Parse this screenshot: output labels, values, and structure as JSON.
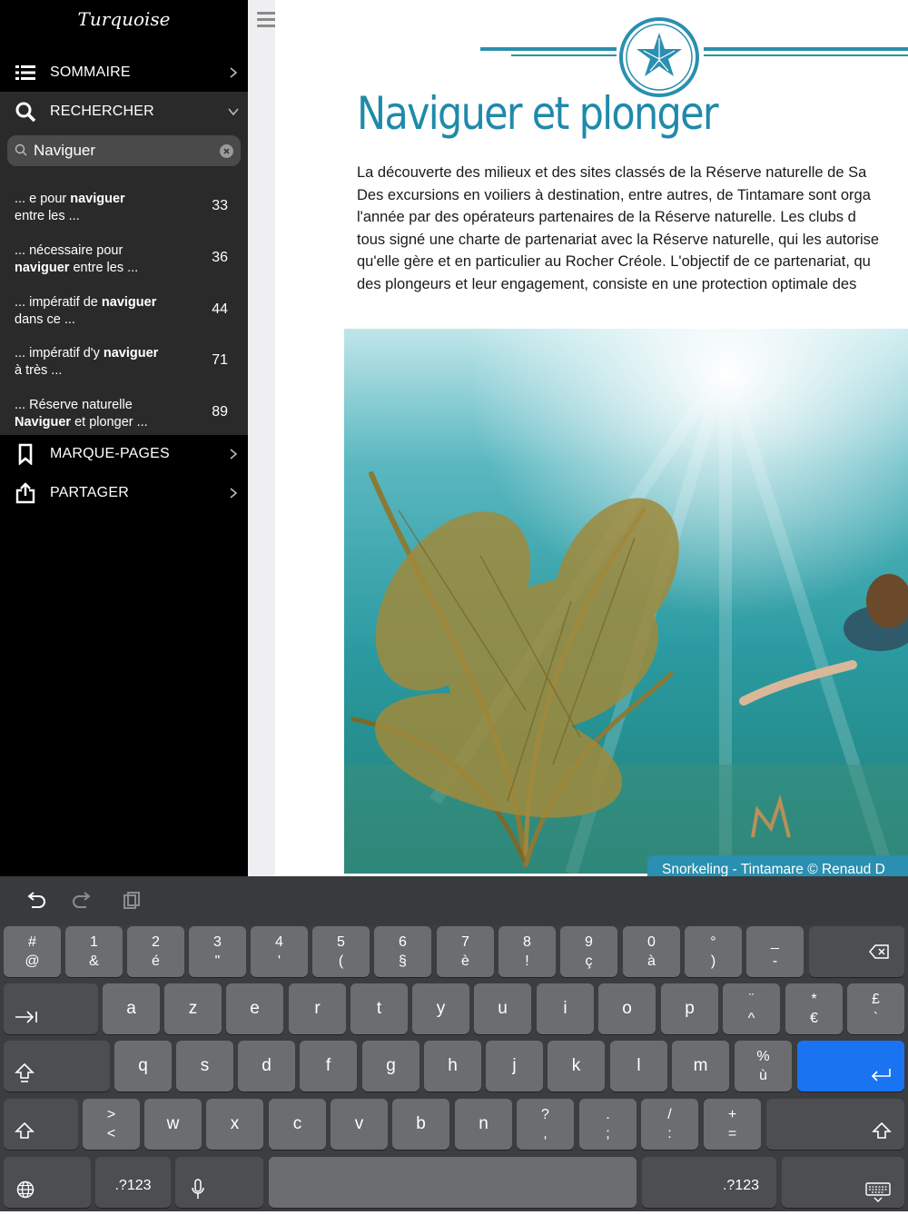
{
  "sidebar": {
    "logo": "Turquoise",
    "menu": {
      "sommaire": "SOMMAIRE",
      "rechercher": "RECHERCHER",
      "marque_pages": "MARQUE-PAGES",
      "partager": "PARTAGER"
    },
    "search": {
      "value": "Naviguer"
    },
    "results": [
      {
        "pre": "... e pour ",
        "hit": "naviguer",
        "post": "",
        "line2": "entre les ...",
        "page": "33"
      },
      {
        "pre": "... nécessaire pour",
        "hit": "",
        "post": "",
        "line2hit": "naviguer",
        "line2": " entre les ...",
        "page": "36"
      },
      {
        "pre": "... impératif de ",
        "hit": "naviguer",
        "post": "",
        "line2": "dans ce ...",
        "page": "44"
      },
      {
        "pre": "... impératif d'y ",
        "hit": "naviguer",
        "post": "",
        "line2": "à très ...",
        "page": "71"
      },
      {
        "pre": "... Réserve naturelle",
        "hit": "",
        "post": "",
        "line2hit": "Naviguer",
        "line2": " et plonger ...",
        "page": "89"
      }
    ]
  },
  "page": {
    "title": "Naviguer et plonger",
    "lines": [
      "La découverte des milieux et des sites classés de la Réserve naturelle de Sa",
      "Des excursions en voiliers à destination, entre autres, de Tintamare sont orga",
      "l'année par des opérateurs partenaires de la Réserve naturelle. Les clubs d",
      "tous signé une charte de partenariat avec la Réserve naturelle, qui les autorise",
      "qu'elle gère et en particulier au Rocher Créole. L'objectif de ce partenariat, qu",
      "des plongeurs et leur engagement, consiste en une protection optimale des"
    ],
    "caption": "Snorkeling  - Tintamare © Renaud D"
  },
  "keyboard": {
    "row1": [
      {
        "top": "#",
        "bot": "@"
      },
      {
        "top": "1",
        "bot": "&"
      },
      {
        "top": "2",
        "bot": "é"
      },
      {
        "top": "3",
        "bot": "\""
      },
      {
        "top": "4",
        "bot": "'"
      },
      {
        "top": "5",
        "bot": "("
      },
      {
        "top": "6",
        "bot": "§"
      },
      {
        "top": "7",
        "bot": "è"
      },
      {
        "top": "8",
        "bot": "!"
      },
      {
        "top": "9",
        "bot": "ç"
      },
      {
        "top": "0",
        "bot": "à"
      },
      {
        "top": "°",
        "bot": ")"
      },
      {
        "top": "_",
        "bot": "-"
      }
    ],
    "row2": [
      "a",
      "z",
      "e",
      "r",
      "t",
      "y",
      "u",
      "i",
      "o",
      "p"
    ],
    "row2_extra": [
      {
        "top": "¨",
        "bot": "^"
      },
      {
        "top": "*",
        "bot": "€"
      },
      {
        "top": "£",
        "bot": "`"
      }
    ],
    "row3": [
      "q",
      "s",
      "d",
      "f",
      "g",
      "h",
      "j",
      "k",
      "l",
      "m"
    ],
    "row3_extra": {
      "top": "%",
      "bot": "ù"
    },
    "row4_first": {
      "top": ">",
      "bot": "<"
    },
    "row4": [
      "w",
      "x",
      "c",
      "v",
      "b",
      "n"
    ],
    "row4_extra": [
      {
        "top": "?",
        "bot": ","
      },
      {
        "top": ".",
        "bot": ";"
      },
      {
        "top": "/",
        "bot": ":"
      },
      {
        "top": "+",
        "bot": "="
      }
    ],
    "num_left": ".?123",
    "num_right": ".?123"
  },
  "colors": {
    "accent": "#1f8aaa",
    "return_key": "#1a73f0"
  }
}
